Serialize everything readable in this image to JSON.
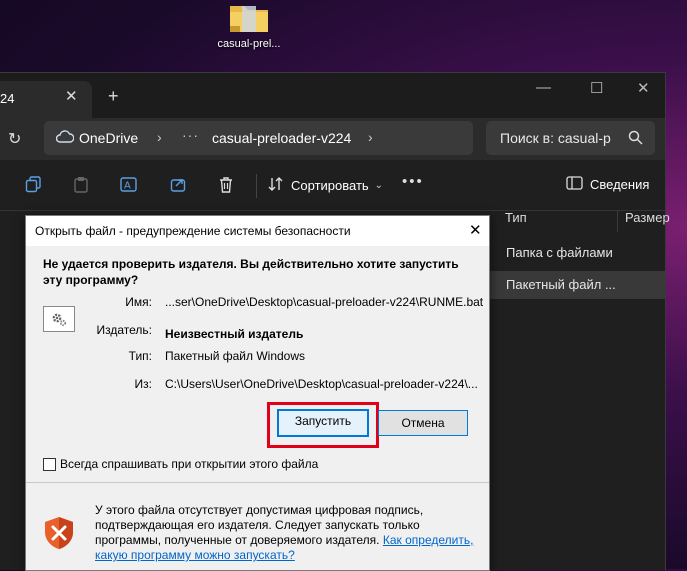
{
  "desktop": {
    "icon_label": "casual-prel..."
  },
  "explorer": {
    "tab_title": "24",
    "address": {
      "root": "OneDrive",
      "ellipsis": "···",
      "folder": "casual-preloader-v224"
    },
    "search_placeholder": "Поиск в: casual-p",
    "toolbar": {
      "sort_label": "Сортировать",
      "details_label": "Сведения"
    },
    "columns": {
      "type": "Тип",
      "size": "Размер"
    },
    "rows": [
      {
        "type": "Папка с файлами"
      },
      {
        "type": "Пакетный файл ..."
      }
    ]
  },
  "dialog": {
    "title": "Открыть файл - предупреждение системы безопасности",
    "heading": "Не удается проверить издателя.  Вы действительно хотите запустить эту программу?",
    "fields": [
      {
        "label": "Имя:",
        "value": "...ser\\OneDrive\\Desktop\\casual-preloader-v224\\RUNME.bat"
      },
      {
        "label": "Издатель:",
        "value": "Неизвестный издатель"
      },
      {
        "label": "Тип:",
        "value": "Пакетный файл Windows"
      },
      {
        "label": "Из:",
        "value": "C:\\Users\\User\\OneDrive\\Desktop\\casual-preloader-v224\\..."
      }
    ],
    "run_button": "Запустить",
    "cancel_button": "Отмена",
    "checkbox_label": "Всегда спрашивать при открытии этого файла",
    "checkbox_checked": false,
    "warning_text": "У этого файла отсутствует допустимая цифровая подпись, подтверждающая его издателя.  Следует запускать только программы, полученные от доверяемого издателя.",
    "warning_link": "Как определить, какую программу можно запускать?"
  },
  "colors": {
    "highlight": "#e0001a",
    "accent": "#0078d7",
    "link": "#0066cc"
  }
}
